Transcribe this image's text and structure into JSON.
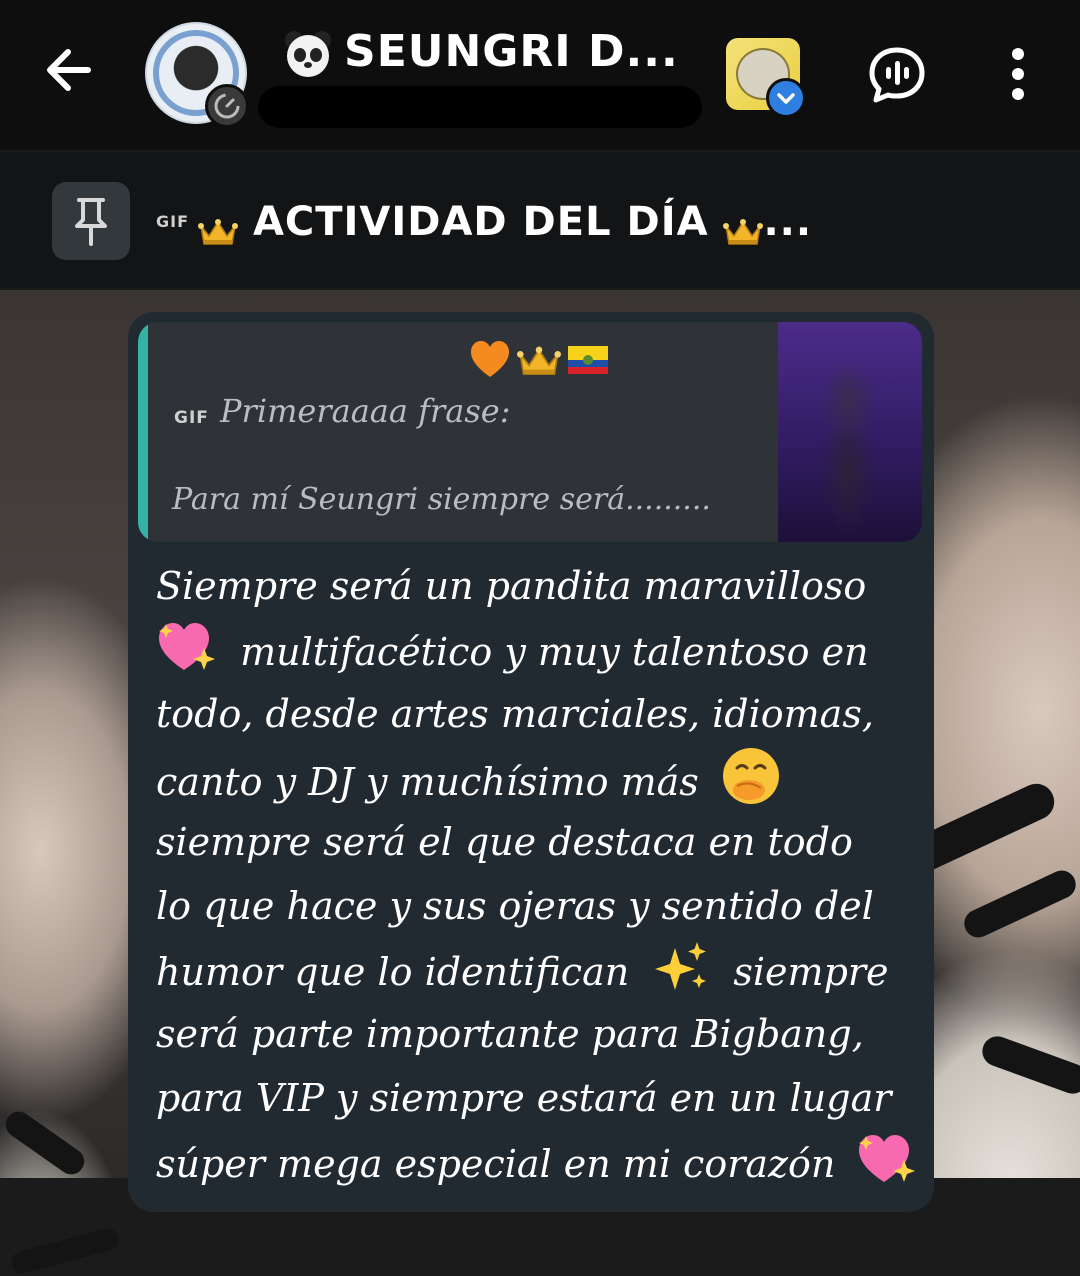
{
  "header": {
    "title": "SEUNGRI D...",
    "title_prefix_icon": "panda-face-icon",
    "back_icon": "arrow-left-icon",
    "voice_icon": "voice-chat-bubble-icon",
    "menu_icon": "more-vertical-icon"
  },
  "pinned": {
    "gif_label": "GIF",
    "text": "ACTIVIDAD DEL DÍA",
    "ellipsis": "...",
    "icon": "pin-icon"
  },
  "message": {
    "reply": {
      "gif_label": "GIF",
      "line1": "Primeraaaa frase:",
      "line2": "Para mí Seungri siempre será.........",
      "accent_color": "#33b3a3"
    },
    "lines": [
      "Siempre será un pandita maravilloso",
      "multifacético y muy talentoso en",
      "todo, desde artes marciales, idiomas,",
      "canto y DJ y muchísimo más",
      "siempre será el que destaca en todo",
      "lo que hace y sus ojeras y sentido del",
      "humor que lo identifican",
      "siempre",
      "será parte importante para Bigbang,",
      "para VIP y siempre estará en un lugar",
      "súper mega especial en mi corazón"
    ]
  }
}
